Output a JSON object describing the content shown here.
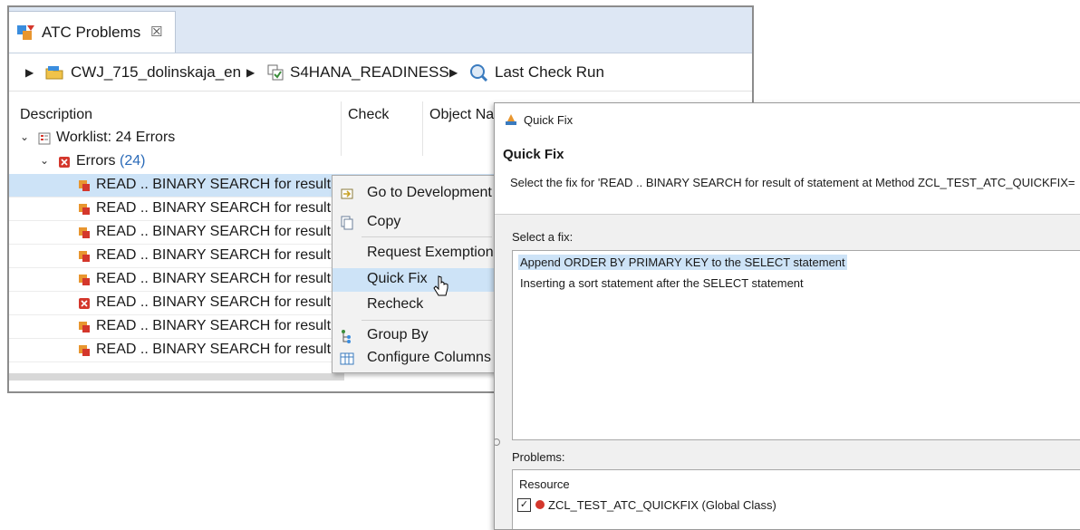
{
  "atc_view": {
    "tab_label": "ATC Problems",
    "tab_close": "☒",
    "breadcrumb": {
      "project": "CWJ_715_dolinskaja_en",
      "variant": "S4HANA_READINESS",
      "run": "Last Check Run"
    },
    "columns": {
      "description": "Description",
      "check": "Check",
      "object_name": "Object Na"
    },
    "tree": {
      "worklist": "Worklist: 24 Errors",
      "errors_label": "Errors",
      "errors_count": "(24)",
      "rows": [
        "READ .. BINARY SEARCH for result",
        "READ .. BINARY SEARCH for result",
        "READ .. BINARY SEARCH for result",
        "READ .. BINARY SEARCH for result",
        "READ .. BINARY SEARCH for result",
        "READ .. BINARY SEARCH for result",
        "READ .. BINARY SEARCH for result",
        "READ .. BINARY SEARCH for result"
      ]
    }
  },
  "context_menu": {
    "items": [
      {
        "label": "Go to Development",
        "icon": "goto-icon"
      },
      {
        "label": "Copy",
        "icon": "copy-icon"
      },
      {
        "label": "Request Exemption",
        "icon": ""
      },
      {
        "label": "Quick Fix",
        "icon": ""
      },
      {
        "label": "Recheck",
        "icon": ""
      },
      {
        "label": "Group By",
        "icon": "group-by-icon"
      },
      {
        "label": "Configure Columns",
        "icon": "configure-columns-icon"
      }
    ]
  },
  "quick_fix": {
    "window_title": "Quick Fix",
    "heading": "Quick Fix",
    "description": "Select the fix for 'READ .. BINARY SEARCH for result of statement at Method ZCL_TEST_ATC_QUICKFIX=",
    "select_label": "Select a fix:",
    "fixes": [
      "Append ORDER BY PRIMARY KEY to the SELECT statement",
      "Inserting a sort statement after the SELECT statement"
    ],
    "problems_label": "Problems:",
    "resource_header": "Resource",
    "resource_check": "✓",
    "resource_name": "ZCL_TEST_ATC_QUICKFIX (Global Class)"
  },
  "colors": {
    "selection": "#cde3f7",
    "tab_bar": "#dde7f4",
    "error_red": "#d4372c",
    "count_blue": "#2a6ab8"
  }
}
